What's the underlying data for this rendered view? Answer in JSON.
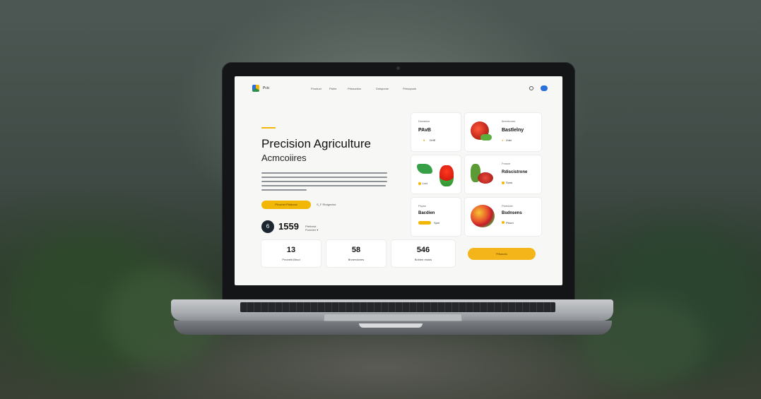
{
  "nav": {
    "brand": "Pcic",
    "links": [
      "Pnoduct",
      "Ptohe",
      "Prbauction",
      "Dnispurse",
      "Prhsopunk"
    ]
  },
  "hero": {
    "title": "Precision Agriculture",
    "subtitle": "Acmcoiires",
    "cta_primary": "Phochst Ptdducst",
    "cta_secondary": "S_F Rtotgectss",
    "stat_icon": "6",
    "stat_value": "1559",
    "stat_caption_1": "Ptetivnst",
    "stat_caption_2": "Ponmter ▾"
  },
  "cards": [
    {
      "label": "Donsteor",
      "title": "PAvB",
      "value": "DHE",
      "mark": "$"
    },
    {
      "label": "Ibrentroner",
      "title": "Bastlelny",
      "value": "Zdst",
      "mark": "1"
    },
    {
      "label": "",
      "title": "",
      "value": "Lod",
      "mark": ""
    },
    {
      "label": "Frosce",
      "title": "Rdiscistrone",
      "value": "Sons",
      "mark": ""
    },
    {
      "label": "Pspse",
      "title": "Bacdien",
      "value": "Spnl",
      "mark": ""
    },
    {
      "label": "Ptotnider",
      "title": "Bsdnsens",
      "value": "Ptrom",
      "mark": ""
    }
  ],
  "metrics": [
    {
      "value": "13",
      "label": "Pnonehl.Brlud"
    },
    {
      "value": "58",
      "label": "Bnnendones"
    },
    {
      "value": "546",
      "label": "Bohlee rirokis"
    }
  ],
  "button_main": "Prtsaodo",
  "colors": {
    "accent": "#f2b705",
    "dark": "#1c2630",
    "nav_btn": "#2a6fdb"
  }
}
